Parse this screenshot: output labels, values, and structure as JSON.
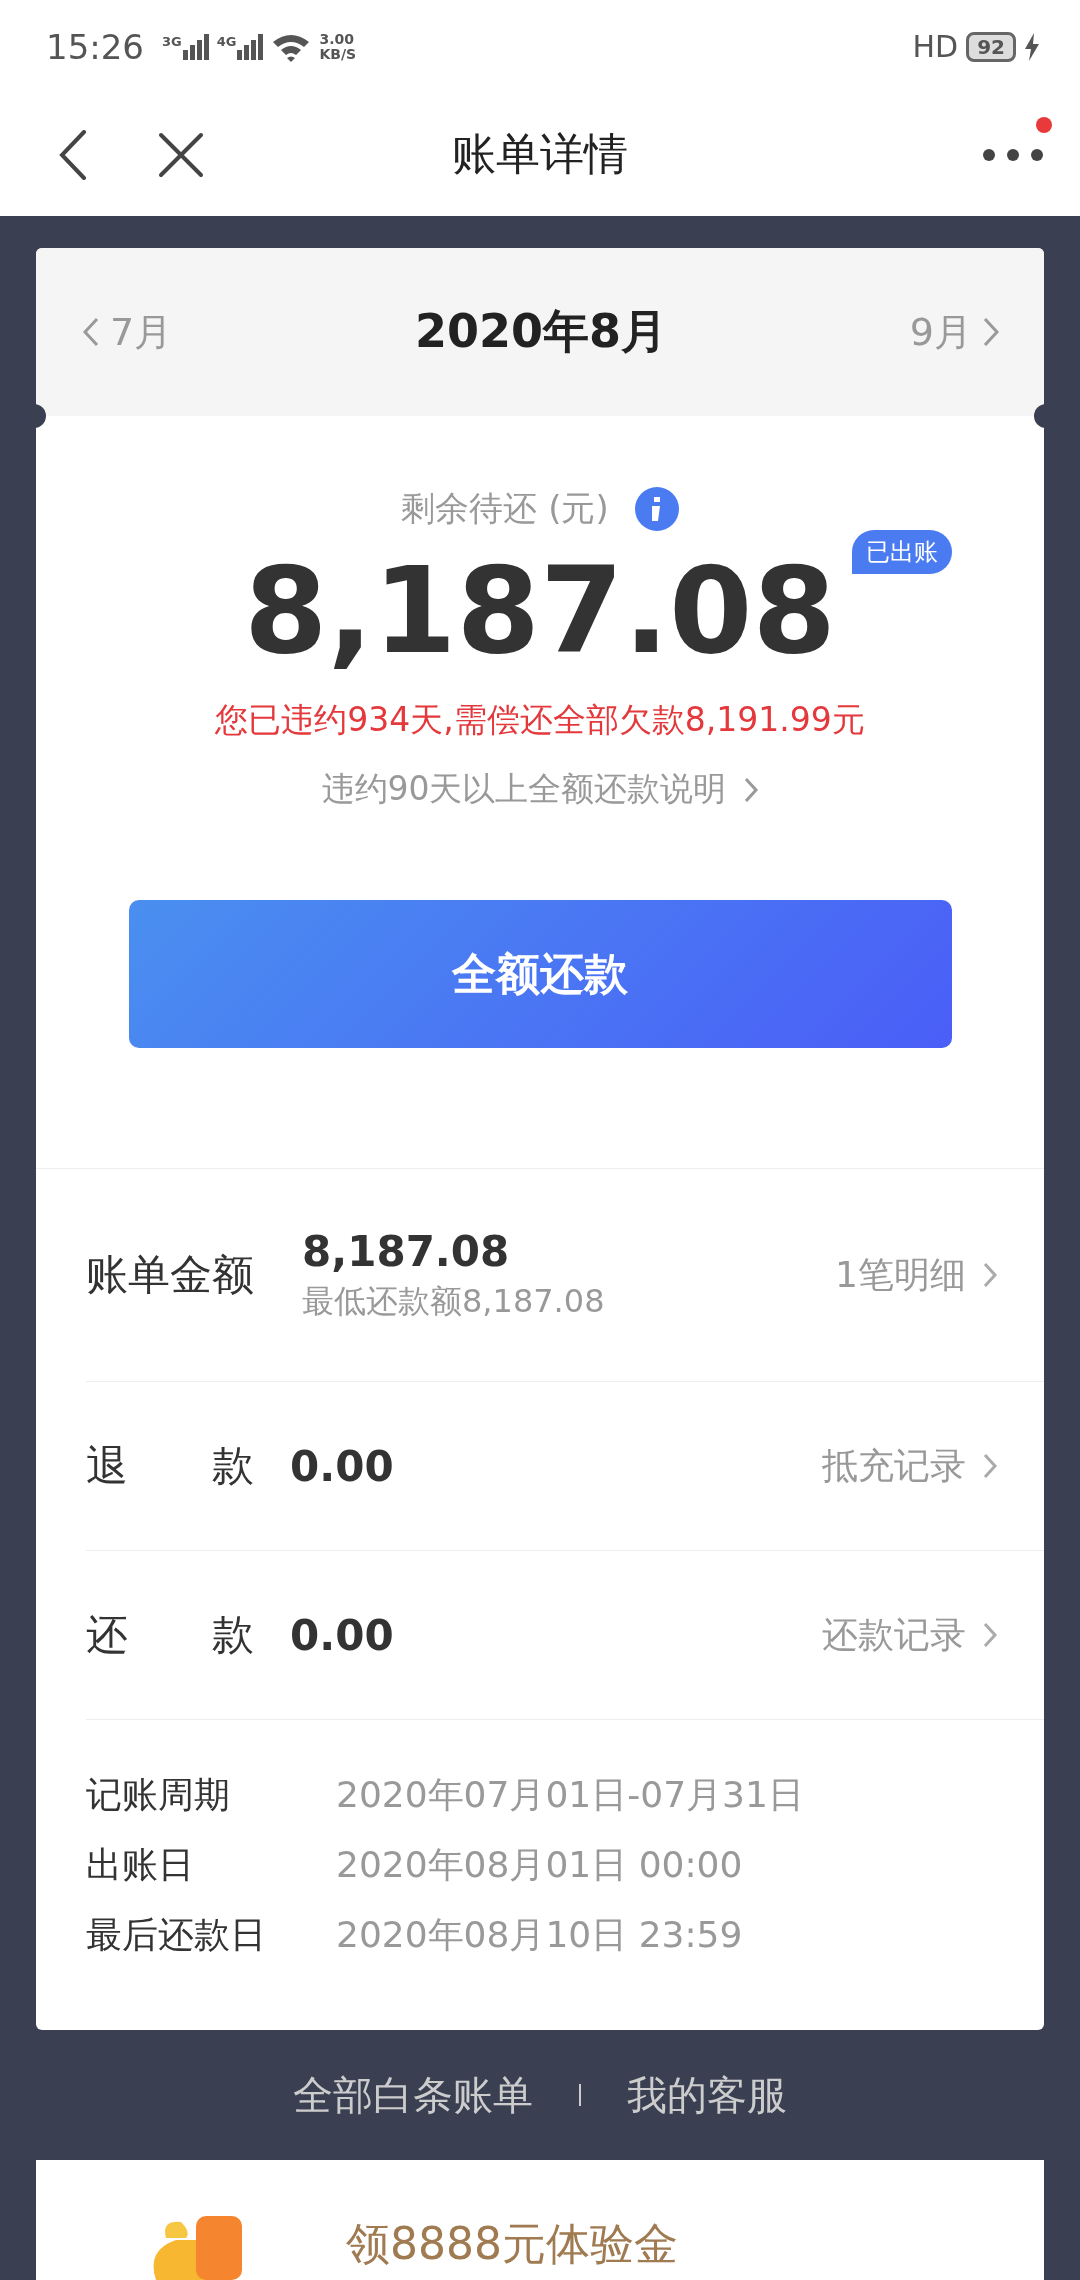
{
  "status_bar": {
    "time": "15:26",
    "net_3g": "3G",
    "net_4g": "4G",
    "speed": "3.00",
    "speed_unit": "KB/S",
    "hd": "HD",
    "battery": "92"
  },
  "nav": {
    "title": "账单详情",
    "has_notification": true
  },
  "month_nav": {
    "prev": "7月",
    "current": "2020年8月",
    "next": "9月"
  },
  "summary": {
    "label": "剩余待还 (元)",
    "amount": "8,187.08",
    "badge": "已出账",
    "warning": "您已违约934天,需偿还全部欠款8,191.99元",
    "link": "违约90天以上全额还款说明",
    "button": "全额还款"
  },
  "bill_rows": [
    {
      "kind": "main",
      "label": "账单金额",
      "amount": "8,187.08",
      "sub": "最低还款额8,187.08",
      "action": "1笔明细"
    },
    {
      "kind": "split",
      "label_a": "退",
      "label_b": "款",
      "amount": "0.00",
      "action": "抵充记录"
    },
    {
      "kind": "split",
      "label_a": "还",
      "label_b": "款",
      "amount": "0.00",
      "action": "还款记录"
    }
  ],
  "info": [
    {
      "label": "记账周期",
      "value": "2020年07月01日-07月31日"
    },
    {
      "label": "出账日",
      "value": "2020年08月01日 00:00"
    },
    {
      "label": "最后还款日",
      "value": "2020年08月10日 23:59"
    }
  ],
  "footer_links": [
    "全部白条账单",
    "我的客服"
  ],
  "banner": {
    "text": "领8888元体验金"
  }
}
